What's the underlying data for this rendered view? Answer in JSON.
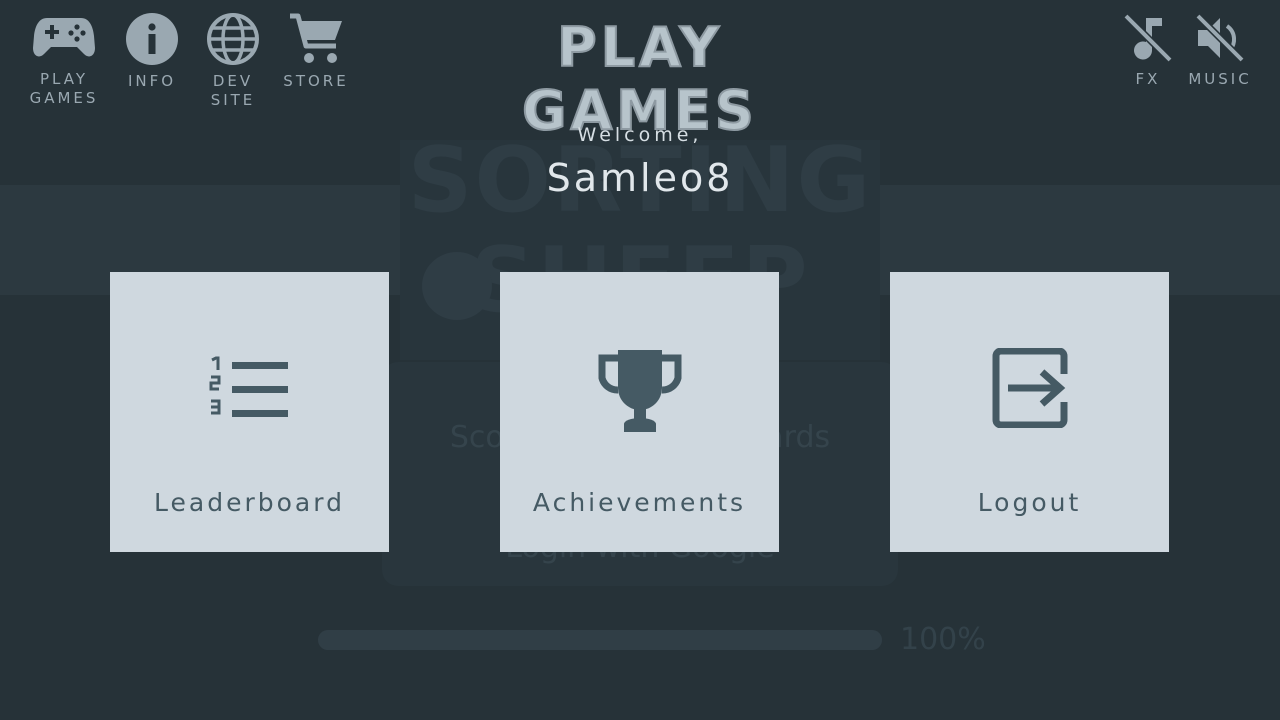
{
  "nav": {
    "play_games": "PLAY\nGAMES",
    "info": "INFO",
    "dev_site": "DEV\nSITE",
    "store": "STORE",
    "fx": "FX",
    "music": "MUSIC"
  },
  "header": {
    "title": "PLAY GAMES",
    "welcome": "Welcome,",
    "username": "Samleo8"
  },
  "cards": [
    {
      "label": "Leaderboard",
      "icon": "leaderboard-icon"
    },
    {
      "label": "Achievements",
      "icon": "trophy-icon"
    },
    {
      "label": "Logout",
      "icon": "logout-icon"
    }
  ],
  "background": {
    "logo_line1": "SORTING",
    "logo_line2": "SHEEP",
    "panel_line1": "Achievements",
    "panel_line2": "Scores and Leaderboards",
    "panel_line3": "Login with Google",
    "progress_label": "100%",
    "progress_value": 1.0
  },
  "colors": {
    "background": "#263238",
    "card": "#cfd8df",
    "card_icon": "#455a64",
    "nav_icon": "#9aa8b1"
  }
}
